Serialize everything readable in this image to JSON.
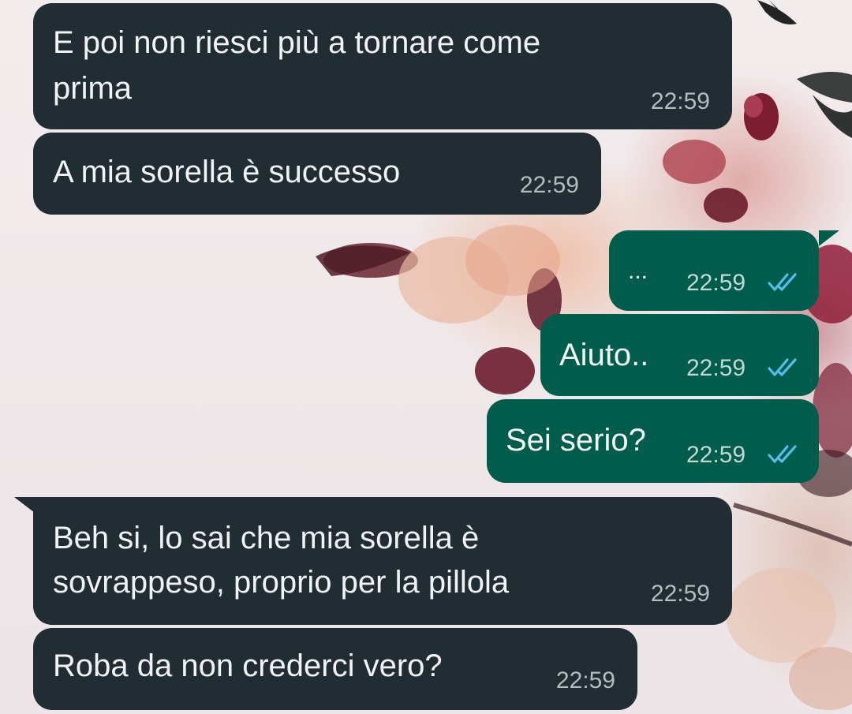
{
  "colors": {
    "incoming_bubble": "#212c33",
    "outgoing_bubble": "#005c4b",
    "read_ticks": "#53bdeb"
  },
  "messages": [
    {
      "direction": "incoming",
      "lines": [
        "E poi non riesci più a tornare come",
        "prima"
      ],
      "time": "22:59"
    },
    {
      "direction": "incoming",
      "lines": [
        "A mia sorella è successo"
      ],
      "time": "22:59"
    },
    {
      "direction": "outgoing",
      "lines": [
        "..."
      ],
      "time": "22:59",
      "status_icon": "double-check-read-icon"
    },
    {
      "direction": "outgoing",
      "lines": [
        "Aiuto.."
      ],
      "time": "22:59",
      "status_icon": "double-check-read-icon"
    },
    {
      "direction": "outgoing",
      "lines": [
        "Sei serio?"
      ],
      "time": "22:59",
      "status_icon": "double-check-read-icon"
    },
    {
      "direction": "incoming",
      "lines": [
        "Beh si, lo sai che mia sorella è",
        "sovrappeso, proprio per la pillola"
      ],
      "time": "22:59"
    },
    {
      "direction": "incoming",
      "lines": [
        "Roba da non crederci vero?"
      ],
      "time": "22:59"
    }
  ]
}
